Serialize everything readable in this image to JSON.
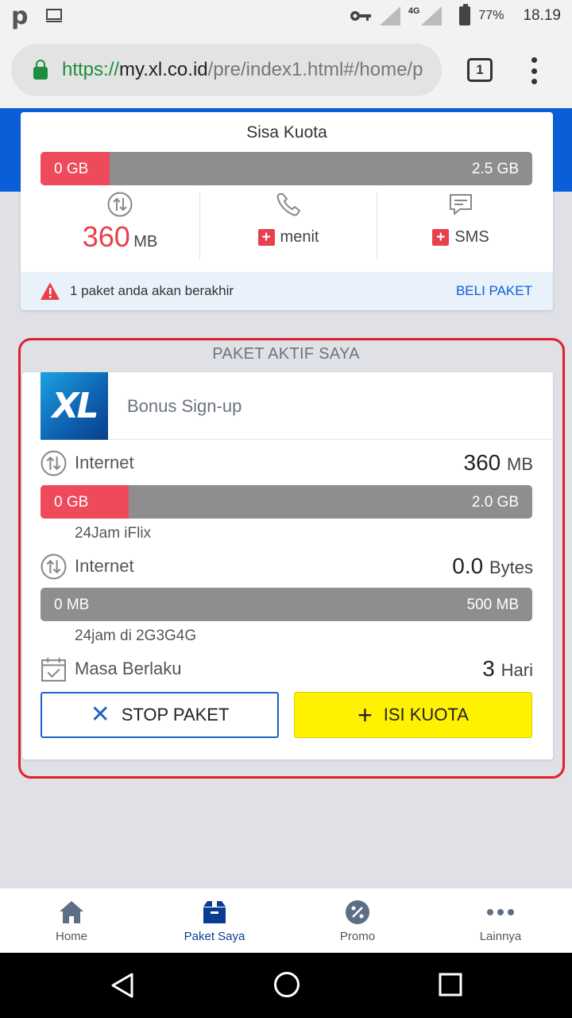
{
  "status_bar": {
    "battery": "77%",
    "time": "18.19",
    "network": "4G"
  },
  "browser": {
    "url_scheme": "https://",
    "url_host": "my.xl.co.id",
    "url_path": "/pre/index1.html#/home/p",
    "tab_count": "1"
  },
  "sisa_kuota": {
    "title": "Sisa Kuota",
    "data_bar": {
      "left": "0 GB",
      "right": "2.5 GB",
      "fill_fraction": 0.14
    },
    "data_value": "360",
    "data_unit": "MB",
    "voice_label": "menit",
    "sms_label": "SMS",
    "plus": "+",
    "alert_text": "1 paket anda akan berakhir",
    "beli_paket": "BELI PAKET"
  },
  "paket_aktif": {
    "title": "PAKET AKTIF SAYA",
    "package_name": "Bonus Sign-up",
    "logo_text": "XL",
    "items": [
      {
        "label": "Internet",
        "value": "360",
        "unit": "MB",
        "bar_left": "0 GB",
        "bar_right": "2.0 GB",
        "fill_fraction": 0.18,
        "desc": "24Jam iFlix"
      },
      {
        "label": "Internet",
        "value": "0.0",
        "unit": "Bytes",
        "bar_left": "0 MB",
        "bar_right": "500 MB",
        "fill_fraction": 0.0,
        "desc": "24jam di 2G3G4G"
      }
    ],
    "masa_berlaku": {
      "label": "Masa Berlaku",
      "value": "3",
      "unit": "Hari"
    },
    "stop_button": "STOP PAKET",
    "isi_button": "ISI KUOTA"
  },
  "bottom_nav": [
    {
      "label": "Home",
      "icon": "home-icon"
    },
    {
      "label": "Paket Saya",
      "icon": "package-icon",
      "active": true
    },
    {
      "label": "Promo",
      "icon": "promo-icon"
    },
    {
      "label": "Lainnya",
      "icon": "more-icon"
    }
  ],
  "colors": {
    "brand_blue": "#0a5fd8",
    "alert_red": "#e8414e",
    "accent_yellow": "#fff200"
  }
}
